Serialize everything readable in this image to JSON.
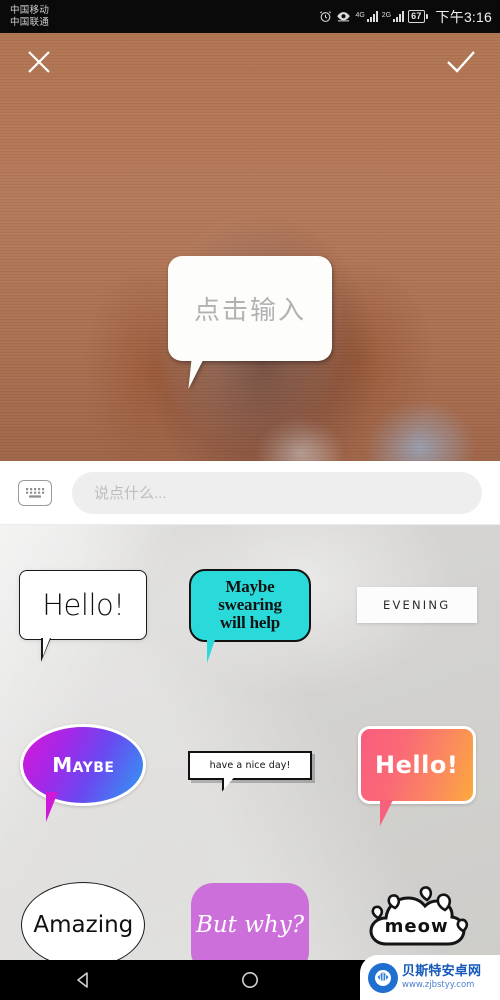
{
  "status_bar": {
    "carrier_1": "中国移动",
    "carrier_2": "中国联通",
    "alarm_icon": "alarm-clock-icon",
    "eye_icon": "eye-care-icon",
    "sim1_network_label": "4G",
    "sim2_network_label": "2G",
    "battery_percent": "67",
    "clock": "下午3:16"
  },
  "editor": {
    "close_label": "×",
    "confirm_label": "✓",
    "overlay_bubble_placeholder": "点击输入"
  },
  "input_bar": {
    "keyboard_icon": "keyboard-icon",
    "placeholder": "说点什么...",
    "value": ""
  },
  "stickers": [
    {
      "id": "hello-outline",
      "text": "Hello!",
      "style": "white outline rounded bubble",
      "color": "#ffffff"
    },
    {
      "id": "maybe-swearing",
      "text": "Maybe\nswearing\nwill help",
      "line1": "Maybe",
      "line2": "swearing",
      "line3": "will help",
      "style": "cyan bubble",
      "color": "#2ad9d9"
    },
    {
      "id": "evening-label",
      "text": "EVENING",
      "style": "white rectangle label",
      "color": "#fcfcfc"
    },
    {
      "id": "maybe-gradient",
      "text": "Maybe",
      "style": "gradient oval bubble",
      "color": "#a229e8"
    },
    {
      "id": "have-a-nice-day",
      "text": "have a nice day!",
      "style": "pixel retro bubble",
      "color": "#ffffff"
    },
    {
      "id": "hello-gradient",
      "text": "Hello!",
      "style": "pink-orange gradient bubble",
      "color": "#f9607c"
    },
    {
      "id": "amazing-ellipse",
      "text": "Amazing",
      "style": "white ellipse outline",
      "color": "#ffffff"
    },
    {
      "id": "but-why-purple",
      "text": "But why?",
      "style": "purple rounded bubble",
      "color": "#cc6fdb"
    },
    {
      "id": "meow-cloud",
      "text": "meow",
      "style": "cloud bubble with hearts",
      "color": "#ffffff"
    }
  ],
  "nav_bar": {
    "back_icon": "back-triangle-icon",
    "home_icon": "home-circle-icon",
    "recents_icon": "recents-square-icon"
  },
  "watermark": {
    "site_name": "贝斯特安卓网",
    "site_url": "www.zjbstyy.com"
  }
}
